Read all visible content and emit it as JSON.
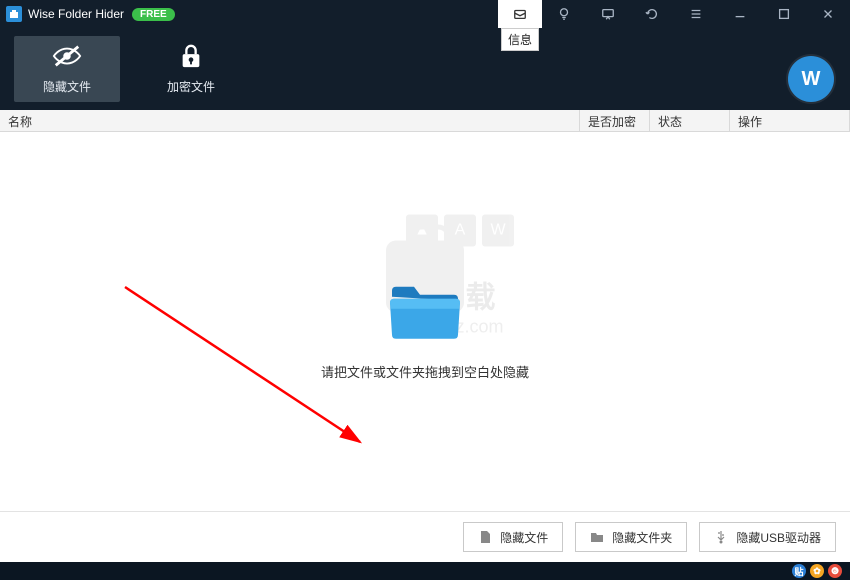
{
  "title": "Wise Folder Hider",
  "badge": "FREE",
  "tooltip_info": "信息",
  "tabs": {
    "hide": "隐藏文件",
    "encrypt": "加密文件"
  },
  "columns": {
    "name": "名称",
    "encrypted": "是否加密",
    "state": "状态",
    "op": "操作"
  },
  "drop_hint": "请把文件或文件夹拖拽到空白处隐藏",
  "footer": {
    "hide_file": "隐藏文件",
    "hide_folder": "隐藏文件夹",
    "hide_usb": "隐藏USB驱动器"
  },
  "brand_letter": "W",
  "watermark": {
    "main": "安下载",
    "sub": "anxz.com"
  },
  "tray_labels": [
    "贴",
    "✿",
    "❻"
  ],
  "colors": {
    "tray1": "#2b7fd6",
    "tray2": "#f5a623",
    "tray3": "#e74c3c"
  }
}
